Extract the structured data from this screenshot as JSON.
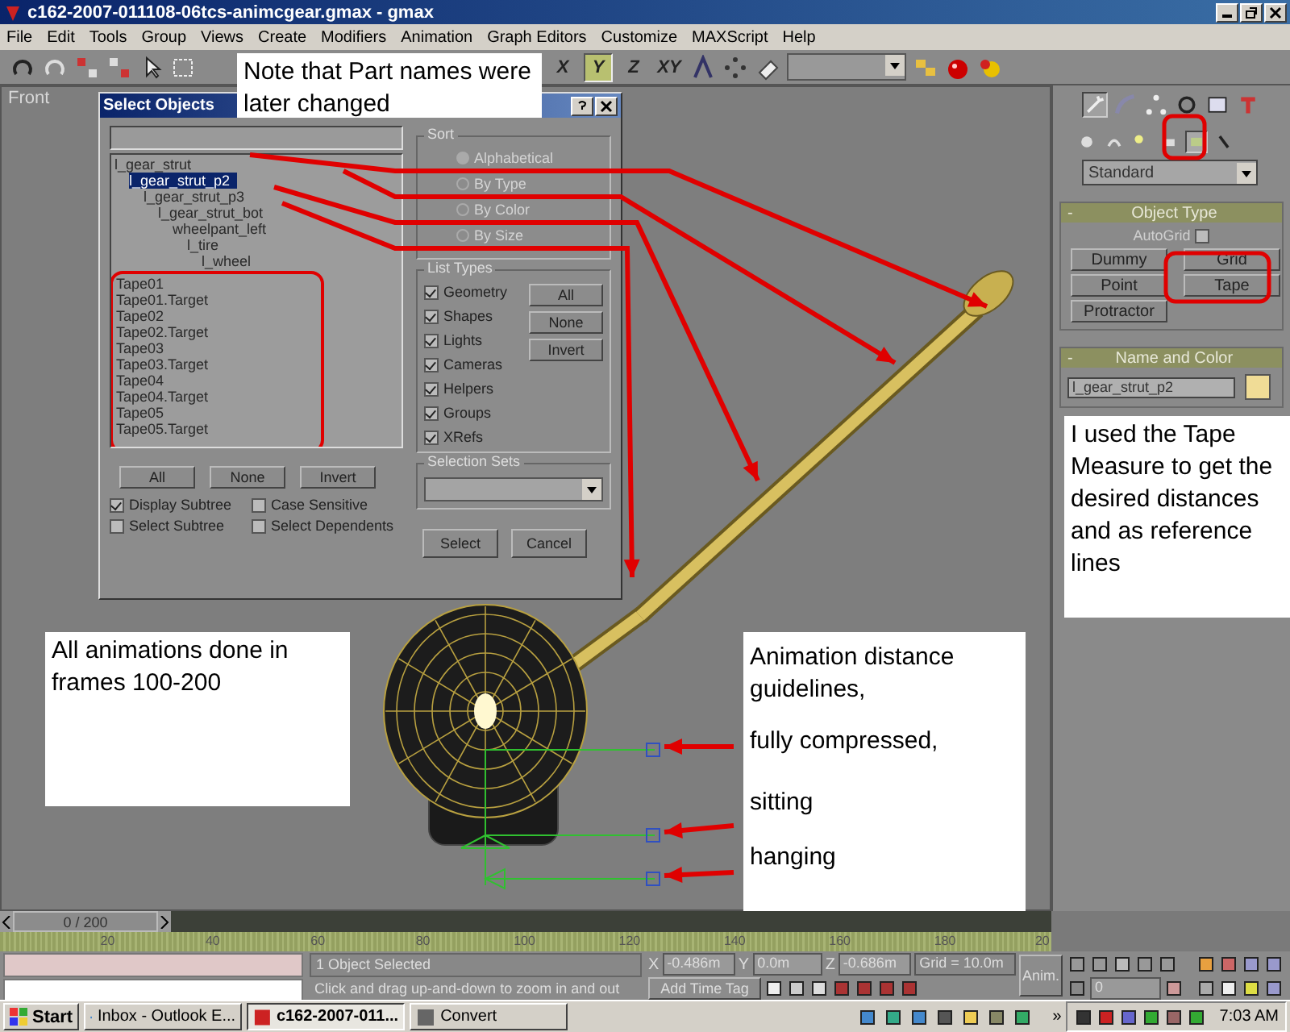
{
  "window": {
    "title": "c162-2007-011108-06tcs-animcgear.gmax - gmax"
  },
  "menu": [
    "File",
    "Edit",
    "Tools",
    "Group",
    "Views",
    "Create",
    "Modifiers",
    "Animation",
    "Graph Editors",
    "Customize",
    "MAXScript",
    "Help"
  ],
  "toolbar": {
    "axes": [
      {
        "label": "X",
        "selected": false
      },
      {
        "label": "Y",
        "selected": true
      },
      {
        "label": "Z",
        "selected": false
      },
      {
        "label": "XY",
        "selected": false
      }
    ]
  },
  "viewport": {
    "label": "Front"
  },
  "dialog": {
    "title": "Select Objects",
    "objects": [
      {
        "name": "l_gear_strut",
        "selected": false,
        "children": [
          {
            "name": "l_gear_strut_p2",
            "selected": true,
            "children": [
              {
                "name": "l_gear_strut_p3",
                "selected": false,
                "children": [
                  {
                    "name": "l_gear_strut_bot",
                    "selected": false,
                    "children": [
                      {
                        "name": "wheelpant_left",
                        "selected": false,
                        "children": [
                          {
                            "name": "l_tire",
                            "selected": false,
                            "children": [
                              {
                                "name": "l_wheel",
                                "selected": false
                              }
                            ]
                          }
                        ]
                      }
                    ]
                  }
                ]
              }
            ]
          }
        ]
      },
      {
        "name": "Tape01",
        "selected": false
      },
      {
        "name": "Tape01.Target",
        "selected": false
      },
      {
        "name": "Tape02",
        "selected": false
      },
      {
        "name": "Tape02.Target",
        "selected": false
      },
      {
        "name": "Tape03",
        "selected": false
      },
      {
        "name": "Tape03.Target",
        "selected": false
      },
      {
        "name": "Tape04",
        "selected": false
      },
      {
        "name": "Tape04.Target",
        "selected": false
      },
      {
        "name": "Tape05",
        "selected": false
      },
      {
        "name": "Tape05.Target",
        "selected": false
      }
    ],
    "sort": {
      "title": "Sort",
      "disabled": true,
      "options": [
        {
          "label": "Alphabetical",
          "selected": true
        },
        {
          "label": "By Type",
          "selected": false
        },
        {
          "label": "By Color",
          "selected": false
        },
        {
          "label": "By Size",
          "selected": false
        }
      ]
    },
    "list_types": {
      "title": "List Types",
      "items": [
        {
          "label": "Geometry",
          "checked": true
        },
        {
          "label": "Shapes",
          "checked": true
        },
        {
          "label": "Lights",
          "checked": true
        },
        {
          "label": "Cameras",
          "checked": true
        },
        {
          "label": "Helpers",
          "checked": true
        },
        {
          "label": "Groups",
          "checked": true
        },
        {
          "label": "XRefs",
          "checked": true
        }
      ],
      "buttons": [
        "All",
        "None",
        "Invert"
      ]
    },
    "selection_sets": {
      "title": "Selection Sets"
    },
    "buttons": [
      "All",
      "None",
      "Invert"
    ],
    "options": [
      {
        "label": "Display Subtree",
        "checked": true
      },
      {
        "label": "Case Sensitive",
        "checked": false
      },
      {
        "label": "Select Subtree",
        "checked": false
      },
      {
        "label": "Select Dependents",
        "checked": false
      }
    ],
    "actions": [
      "Select",
      "Cancel"
    ]
  },
  "command_panel": {
    "tabs": [
      {
        "selected": true
      },
      {
        "selected": false
      },
      {
        "selected": false
      },
      {
        "selected": false
      },
      {
        "selected": false
      },
      {
        "selected": false
      }
    ],
    "categories": [
      {
        "selected": false
      },
      {
        "selected": false
      },
      {
        "selected": false
      },
      {
        "selected": false
      },
      {
        "selected": true
      },
      {
        "selected": false
      }
    ],
    "type_dropdown": "Standard",
    "object_type": {
      "toggle": "-",
      "title": "Object Type",
      "autogrid": {
        "label": "AutoGrid",
        "checked": false,
        "disabled": true
      },
      "buttons": [
        {
          "label": "Dummy",
          "selected": false
        },
        {
          "label": "Grid",
          "selected": false
        },
        {
          "label": "Point",
          "selected": false
        },
        {
          "label": "Tape",
          "selected": false
        },
        {
          "label": "Protractor",
          "selected": false
        }
      ]
    },
    "name_and_color": {
      "toggle": "-",
      "title": "Name and Color",
      "name": "l_gear_strut_p2",
      "color": "#f0dc96"
    }
  },
  "notes": [
    {
      "paragraphs": [
        "Note that Part names were later changed"
      ]
    },
    {
      "paragraphs": [
        "I used the Tape Measure to get the desired distances and as reference lines"
      ]
    },
    {
      "paragraphs": [
        "All animations done in frames 100-200"
      ]
    },
    {
      "paragraphs": [
        "Animation distance guidelines,",
        "fully compressed,",
        "sitting",
        "hanging"
      ]
    }
  ],
  "timeline": {
    "position": "0 / 200",
    "level": 0,
    "ticks": [
      "20",
      "40",
      "60",
      "80",
      "100",
      "120",
      "140",
      "160",
      "180",
      "20"
    ]
  },
  "status": {
    "axis_labels": [
      "X",
      "Y",
      "Z"
    ],
    "selection": "1 Object Selected",
    "prompt": "Click and drag up-and-down to zoom in and out",
    "x": "-0.486m",
    "y": "0.0m",
    "z": "-0.686m",
    "grid": "Grid = 10.0m",
    "time_tag": "Add Time Tag",
    "anim": "Anim.",
    "frame": "0"
  },
  "taskbar": {
    "start": "Start",
    "tasks": [
      {
        "label": "Inbox - Outlook E...",
        "selected": false
      },
      {
        "label": "c162-2007-011...",
        "selected": true
      },
      {
        "label": "Convert",
        "selected": false
      }
    ],
    "chevron": "»",
    "clock": "7:03 AM"
  }
}
